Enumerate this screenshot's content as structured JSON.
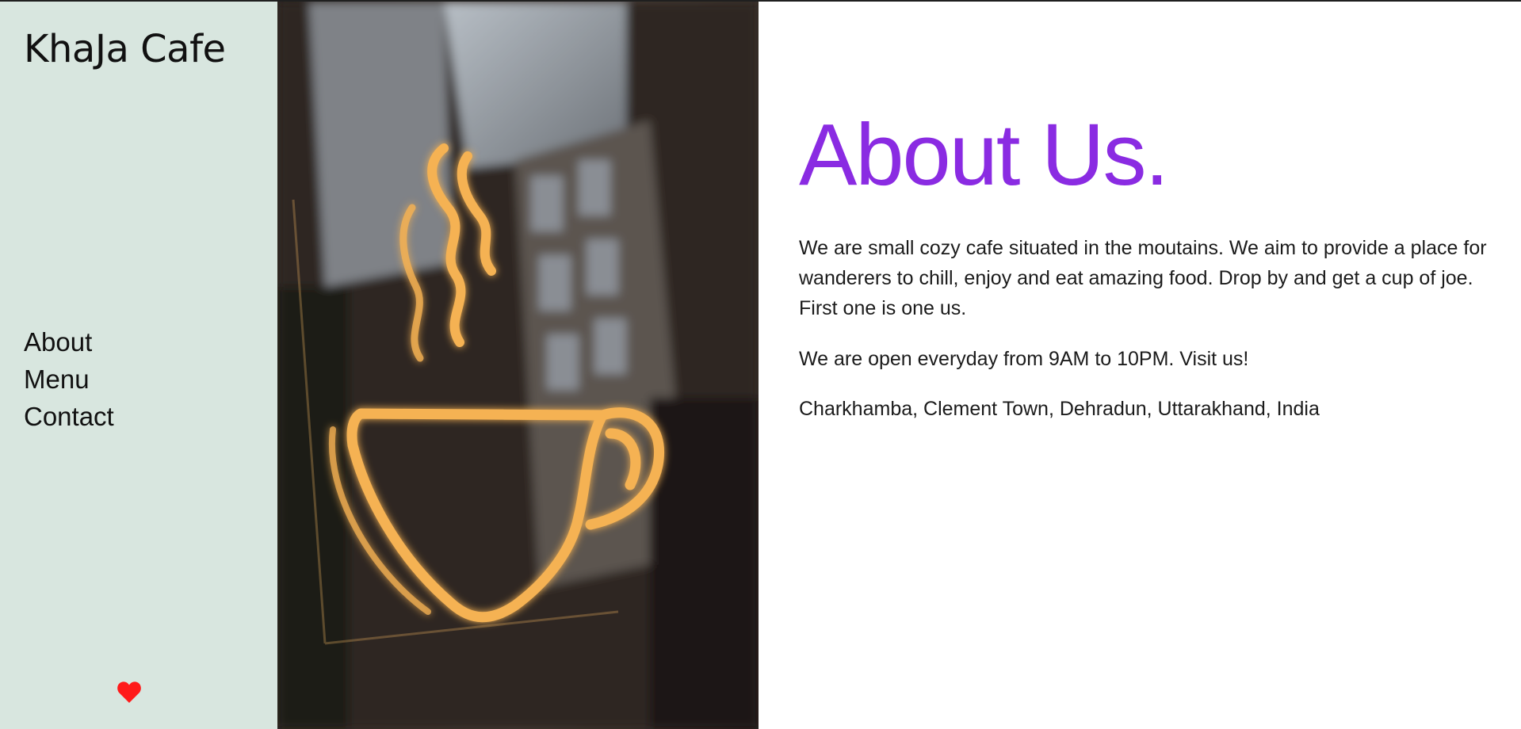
{
  "sidebar": {
    "brand": "KhaJa Cafe",
    "nav": [
      {
        "label": "About"
      },
      {
        "label": "Menu"
      },
      {
        "label": "Contact"
      }
    ],
    "heart_color": "#ff1a1a",
    "heart_icon": "heart-icon"
  },
  "photo": {
    "subject": "neon-coffee-cup-sign",
    "neon_color": "#f5b253"
  },
  "main": {
    "title": "About Us.",
    "title_color": "#8a2be2",
    "paragraphs": [
      "We are small cozy cafe situated in the moutains. We aim to provide a place for wanderers to chill, enjoy and eat amazing food. Drop by and get a cup of joe. First one is one us.",
      "We are open everyday from 9AM to 10PM. Visit us!",
      "Charkhamba, Clement Town, Dehradun, Uttarakhand, India"
    ]
  },
  "colors": {
    "sidebar_bg": "#d8e6df",
    "text": "#111111"
  }
}
